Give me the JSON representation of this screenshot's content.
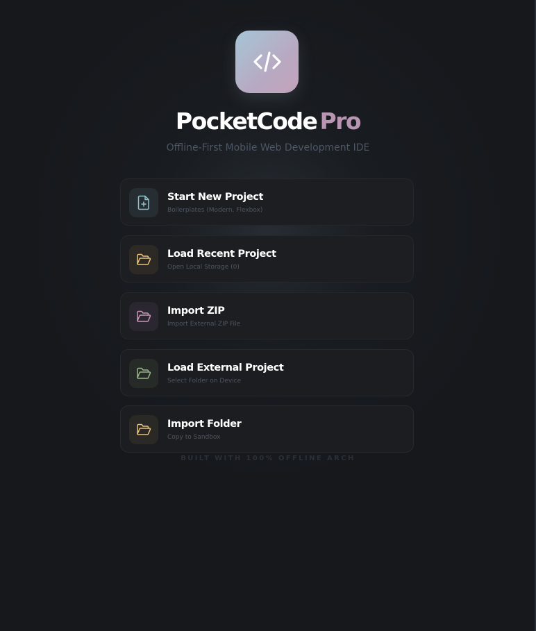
{
  "app": {
    "logo_icon": "code-icon",
    "title_main": "PocketCode",
    "title_accent": "Pro",
    "subtitle": "Offline-First Mobile Web Development IDE"
  },
  "colors": {
    "background": "#16181c",
    "accent_pro": "#b795b3",
    "card_bg": "#1c1e22"
  },
  "menu": [
    {
      "label": "Start New Project",
      "description": "Boilerplates (Modern, Flexbox)",
      "icon": "file-plus-icon",
      "icon_color": "#8fc3cf"
    },
    {
      "label": "Load Recent Project",
      "description": "Open Local Storage (0)",
      "icon": "folder-open-icon",
      "icon_color": "#e8c37e"
    },
    {
      "label": "Import ZIP",
      "description": "Import External ZIP File",
      "icon": "folder-open-icon",
      "icon_color": "#c89ab6"
    },
    {
      "label": "Load External Project",
      "description": "Select Folder on Device",
      "icon": "folder-open-icon",
      "icon_color": "#9bb58d"
    },
    {
      "label": "Import Folder",
      "description": "Copy to Sandbox",
      "icon": "folder-open-icon",
      "icon_color": "#e8c37e"
    }
  ],
  "footer": "BUILT WITH 100% OFFLINE ARCH"
}
